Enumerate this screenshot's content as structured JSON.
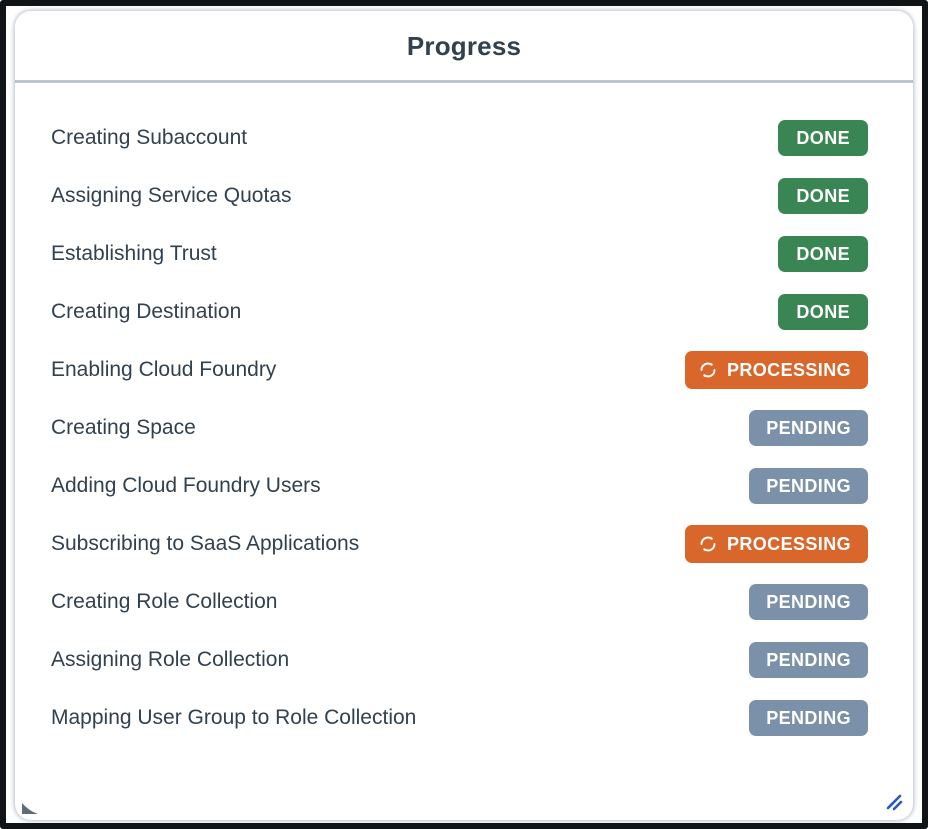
{
  "window": {
    "title": "Progress",
    "resize_handle_icon": "resize-grip-icon",
    "corner_grip_icon": "corner-grip-icon"
  },
  "colors": {
    "done": "#3a8554",
    "processing": "#d9662b",
    "pending": "#7b90a9",
    "text": "#32414f",
    "divider": "#b9c4d0",
    "resize_handle": "#2b57c4"
  },
  "statuses": {
    "done_label": "DONE",
    "processing_label": "PROCESSING",
    "pending_label": "PENDING",
    "processing_icon": "sync-spinner-icon"
  },
  "tasks": [
    {
      "label": "Creating Subaccount",
      "status": "DONE",
      "state": "done"
    },
    {
      "label": "Assigning Service Quotas",
      "status": "DONE",
      "state": "done"
    },
    {
      "label": "Establishing Trust",
      "status": "DONE",
      "state": "done"
    },
    {
      "label": "Creating Destination",
      "status": "DONE",
      "state": "done"
    },
    {
      "label": "Enabling Cloud Foundry",
      "status": "PROCESSING",
      "state": "processing"
    },
    {
      "label": "Creating Space",
      "status": "PENDING",
      "state": "pending"
    },
    {
      "label": "Adding Cloud Foundry Users",
      "status": "PENDING",
      "state": "pending"
    },
    {
      "label": "Subscribing to SaaS Applications",
      "status": "PROCESSING",
      "state": "processing"
    },
    {
      "label": "Creating Role Collection",
      "status": "PENDING",
      "state": "pending"
    },
    {
      "label": "Assigning Role Collection",
      "status": "PENDING",
      "state": "pending"
    },
    {
      "label": "Mapping User Group to Role Collection",
      "status": "PENDING",
      "state": "pending"
    }
  ]
}
